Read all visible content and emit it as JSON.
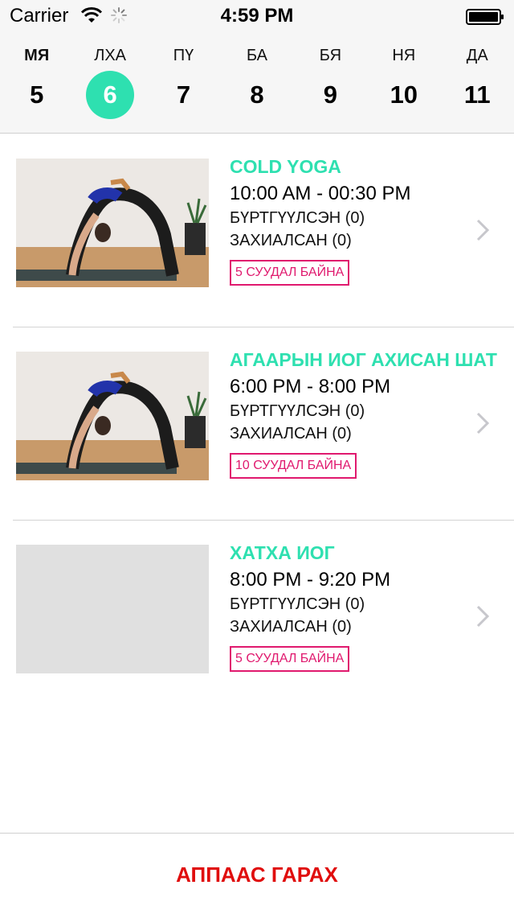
{
  "status_bar": {
    "carrier": "Carrier",
    "time": "4:59 PM",
    "icons": [
      "wifi-icon",
      "activity-spinner-icon",
      "battery-icon"
    ]
  },
  "week": {
    "days": [
      {
        "name": "МЯ",
        "num": "5"
      },
      {
        "name": "ЛХА",
        "num": "6"
      },
      {
        "name": "ПҮ",
        "num": "7"
      },
      {
        "name": "БА",
        "num": "8"
      },
      {
        "name": "БЯ",
        "num": "9"
      },
      {
        "name": "НЯ",
        "num": "10"
      },
      {
        "name": "ДА",
        "num": "11"
      }
    ],
    "selected_index": 1
  },
  "classes": [
    {
      "title": "COLD YOGA",
      "time": "10:00 AM - 00:30 PM",
      "registered": "БҮРТГҮҮЛСЭН (0)",
      "booked": "ЗАХИАЛСАН (0)",
      "badge": "5 СУУДАЛ БАЙНА",
      "has_image": true
    },
    {
      "title": "АГААРЫН ИОГ АХИСАН ШАТ",
      "time": "6:00 PM - 8:00 PM",
      "registered": "БҮРТГҮҮЛСЭН (0)",
      "booked": "ЗАХИАЛСАН (0)",
      "badge": "10 СУУДАЛ БАЙНА",
      "has_image": true
    },
    {
      "title": "ХАТХА ИОГ",
      "time": "8:00 PM - 9:20 PM",
      "registered": "БҮРТГҮҮЛСЭН (0)",
      "booked": "ЗАХИАЛСАН (0)",
      "badge": "5 СУУДАЛ БАЙНА",
      "has_image": false
    }
  ],
  "footer": {
    "logout_label": "АППААС ГАРАХ"
  },
  "colors": {
    "accent": "#2ee0b0",
    "badge": "#e0196e",
    "logout": "#e00d0d"
  }
}
